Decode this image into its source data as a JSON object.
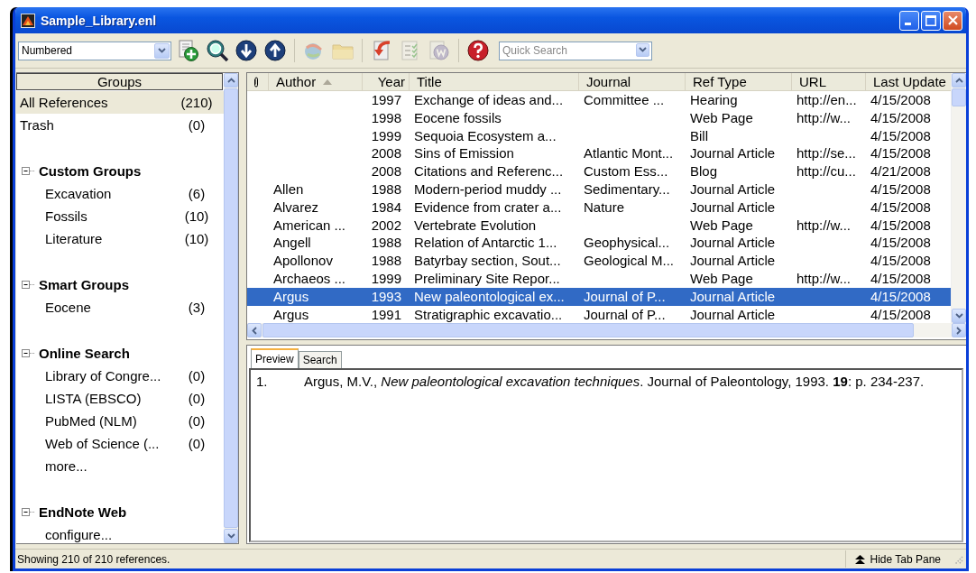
{
  "window": {
    "title": "Sample_Library.enl"
  },
  "toolbar": {
    "style": "Numbered",
    "buttons": [
      {
        "kind": "new-reference",
        "disabled": false
      },
      {
        "kind": "online-search",
        "disabled": false
      },
      {
        "kind": "import",
        "disabled": false
      },
      {
        "kind": "export",
        "disabled": false
      },
      {
        "kind": "find-full-text",
        "disabled": true
      },
      {
        "kind": "open-link",
        "disabled": true
      },
      {
        "kind": "insert-citation",
        "disabled": false
      },
      {
        "kind": "format-bibliography",
        "disabled": true
      },
      {
        "kind": "word",
        "disabled": true
      },
      {
        "kind": "help",
        "disabled": false
      }
    ],
    "search": {
      "placeholder": "Quick Search"
    }
  },
  "groups": {
    "header": "Groups",
    "items": [
      {
        "label": "All References",
        "count": "(210)",
        "selected": true
      },
      {
        "label": "Trash",
        "count": "(0)",
        "selected": false
      }
    ],
    "sections": [
      {
        "title": "Custom Groups",
        "expanded": true,
        "items": [
          {
            "label": "Excavation",
            "count": "(6)",
            "selected": false
          },
          {
            "label": "Fossils",
            "count": "(10)",
            "selected": false
          },
          {
            "label": "Literature",
            "count": "(10)",
            "selected": false
          }
        ]
      },
      {
        "title": "Smart Groups",
        "expanded": true,
        "items": [
          {
            "label": "Eocene",
            "count": "(3)",
            "selected": false
          }
        ]
      },
      {
        "title": "Online Search",
        "expanded": true,
        "items": [
          {
            "label": "Library of Congre...",
            "count": "(0)",
            "selected": false
          },
          {
            "label": "LISTA (EBSCO)",
            "count": "(0)",
            "selected": false
          },
          {
            "label": "PubMed (NLM)",
            "count": "(0)",
            "selected": false
          },
          {
            "label": "Web of Science (...",
            "count": "(0)",
            "selected": false
          },
          {
            "label": "more...",
            "selected": false
          }
        ]
      },
      {
        "title": "EndNote Web",
        "expanded": true,
        "items": [
          {
            "label": "configure...",
            "selected": false
          }
        ]
      }
    ]
  },
  "table": {
    "columns": [
      {
        "label": "Author",
        "sorted": true
      },
      {
        "label": "Year",
        "sorted": false
      },
      {
        "label": "Title",
        "sorted": false
      },
      {
        "label": "Journal",
        "sorted": false
      },
      {
        "label": "Ref Type",
        "sorted": false
      },
      {
        "label": "URL",
        "sorted": false
      },
      {
        "label": "Last Update",
        "sorted": false
      }
    ],
    "rows": [
      {
        "cells": [
          "",
          "1997",
          "Exchange of ideas and...",
          "Committee ...",
          "Hearing",
          "http://en...",
          "4/15/2008"
        ],
        "selected": false
      },
      {
        "cells": [
          "",
          "1998",
          "Eocene fossils",
          "",
          "Web Page",
          "http://w...",
          "4/15/2008"
        ],
        "selected": false
      },
      {
        "cells": [
          "",
          "1999",
          "Sequoia Ecosystem a...",
          "",
          "Bill",
          "",
          "4/15/2008"
        ],
        "selected": false
      },
      {
        "cells": [
          "",
          "2008",
          "Sins of Emission",
          "Atlantic Mont...",
          "Journal Article",
          "http://se...",
          "4/15/2008"
        ],
        "selected": false
      },
      {
        "cells": [
          "",
          "2008",
          "Citations and Referenc...",
          "Custom Ess...",
          "Blog",
          "http://cu...",
          "4/21/2008"
        ],
        "selected": false
      },
      {
        "cells": [
          "Allen",
          "1988",
          "Modern-period muddy ...",
          "Sedimentary...",
          "Journal Article",
          "",
          "4/15/2008"
        ],
        "selected": false
      },
      {
        "cells": [
          "Alvarez",
          "1984",
          "Evidence from crater a...",
          "Nature",
          "Journal Article",
          "",
          "4/15/2008"
        ],
        "selected": false
      },
      {
        "cells": [
          "American ...",
          "2002",
          "Vertebrate Evolution",
          "",
          "Web Page",
          "http://w...",
          "4/15/2008"
        ],
        "selected": false
      },
      {
        "cells": [
          "Angell",
          "1988",
          "Relation of Antarctic 1...",
          "Geophysical...",
          "Journal Article",
          "",
          "4/15/2008"
        ],
        "selected": false
      },
      {
        "cells": [
          "Apollonov",
          "1988",
          "Batyrbay section, Sout...",
          "Geological M...",
          "Journal Article",
          "",
          "4/15/2008"
        ],
        "selected": false
      },
      {
        "cells": [
          "Archaeos ...",
          "1999",
          "Preliminary Site Repor...",
          "",
          "Web Page",
          "http://w...",
          "4/15/2008"
        ],
        "selected": false
      },
      {
        "cells": [
          "Argus",
          "1993",
          "New paleontological ex...",
          "Journal of P...",
          "Journal Article",
          "",
          "4/15/2008"
        ],
        "selected": true
      },
      {
        "cells": [
          "Argus",
          "1991",
          "Stratigraphic excavatio...",
          "Journal of P...",
          "Journal Article",
          "",
          "4/15/2008"
        ],
        "selected": false
      }
    ]
  },
  "preview": {
    "tabs": [
      {
        "label": "Preview",
        "selected": true
      },
      {
        "label": "Search",
        "selected": false
      }
    ],
    "number": "1.",
    "citation": "Argus, M.V., *New paleontological excavation techniques*. Journal of Paleontology, 1993. **19**: p. 234-237."
  },
  "status_bar": {
    "text": "Showing 210 of 210 references.",
    "hide_tab_pane": "Hide Tab Pane"
  }
}
